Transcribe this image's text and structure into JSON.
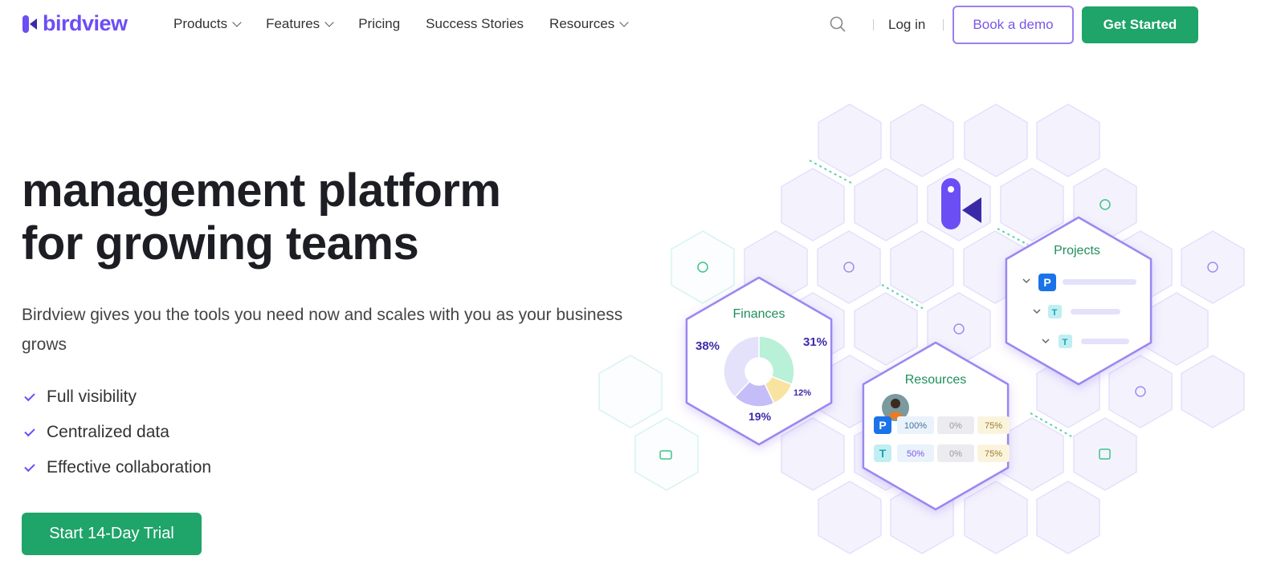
{
  "brand": {
    "name": "birdview",
    "color": "#6c4ef5"
  },
  "nav": {
    "items": [
      {
        "label": "Products",
        "dropdown": true
      },
      {
        "label": "Features",
        "dropdown": true
      },
      {
        "label": "Pricing",
        "dropdown": false
      },
      {
        "label": "Success Stories",
        "dropdown": false
      },
      {
        "label": "Resources",
        "dropdown": true
      }
    ],
    "login": "Log in",
    "demo": "Book a demo",
    "started": "Get Started"
  },
  "hero": {
    "title_line1": "management platform",
    "title_line2": "for growing teams",
    "subtitle": "Birdview gives you the tools you need now and scales with you as your business grows",
    "features": [
      "Full visibility",
      "Centralized data",
      "Effective collaboration"
    ],
    "cta": "Start 14-Day Trial"
  },
  "illustration": {
    "finances": {
      "title": "Finances",
      "slices": [
        {
          "label": "31%",
          "value": 31,
          "color": "#b8f0d8"
        },
        {
          "label": "12%",
          "value": 12,
          "color": "#f8e4a0"
        },
        {
          "label": "19%",
          "value": 19,
          "color": "#c4bdf7"
        },
        {
          "label": "38%",
          "value": 38,
          "color": "#e4e1fb"
        }
      ]
    },
    "resources": {
      "title": "Resources",
      "rows": [
        {
          "tag": "P",
          "cells": [
            "100%",
            "0%",
            "75%"
          ]
        },
        {
          "tag": "T",
          "cells": [
            "50%",
            "0%",
            "75%"
          ]
        }
      ]
    },
    "projects": {
      "title": "Projects",
      "rows": [
        "P",
        "T",
        "T"
      ]
    }
  },
  "colors": {
    "green": "#1fa46a",
    "purple": "#7c55e8"
  }
}
